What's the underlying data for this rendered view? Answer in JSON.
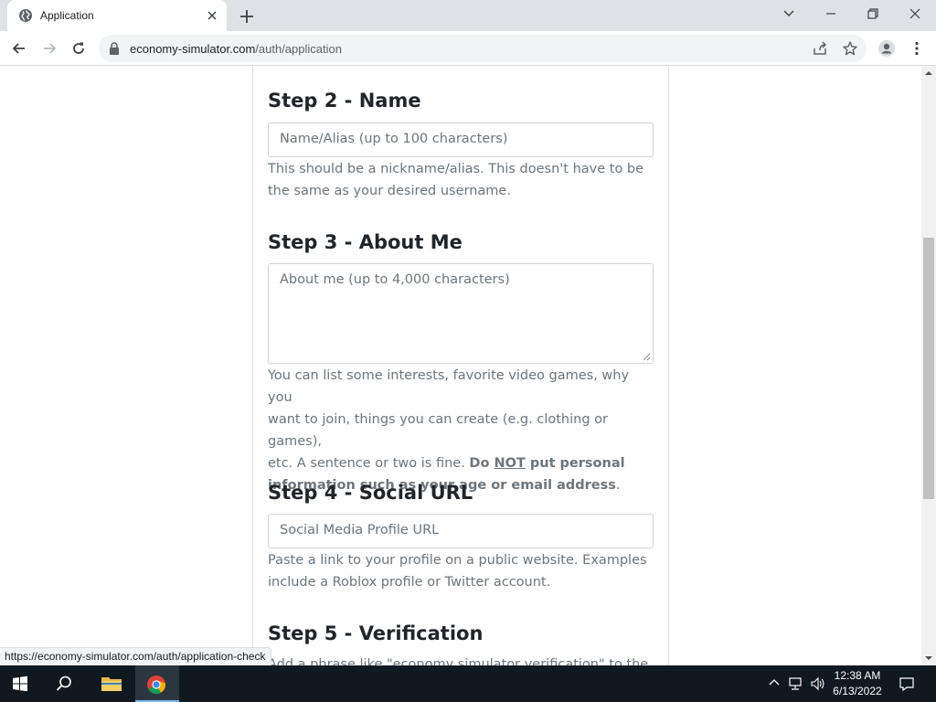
{
  "browser": {
    "tab_title": "Application",
    "url_host": "economy-simulator.com",
    "url_path": "/auth/application"
  },
  "form": {
    "step2": {
      "heading": "Step 2 - Name",
      "placeholder": "Name/Alias (up to 100 characters)",
      "help_line1": "This should be a nickname/alias. This doesn't have to be",
      "help_line2": "the same as your desired username."
    },
    "step3": {
      "heading": "Step 3 - About Me",
      "placeholder": "About me (up to 4,000 characters)",
      "help_line1": "You can list some interests, favorite video games, why you",
      "help_line2": "want to join, things you can create (e.g. clothing or games),",
      "help_line3_start": "etc. A sentence or two is fine. ",
      "help_bold_do": "Do ",
      "help_bold_not": "NOT",
      "help_bold_rest_line3": " put personal",
      "help_bold_line4": "information such as your age or email address",
      "help_end": "."
    },
    "step4": {
      "heading": "Step 4 - Social URL",
      "placeholder": "Social Media Profile URL",
      "help_line1": "Paste a link to your profile on a public website. Examples",
      "help_line2": "include a Roblox profile or Twitter account."
    },
    "step5": {
      "heading": "Step 5 - Verification",
      "help_partial": "Add a phrase like \"economy simulator verification\" to the"
    }
  },
  "status_bar": {
    "hover_url": "https://economy-simulator.com/auth/application-check"
  },
  "taskbar": {
    "time": "12:38 AM",
    "date": "6/13/2022"
  }
}
